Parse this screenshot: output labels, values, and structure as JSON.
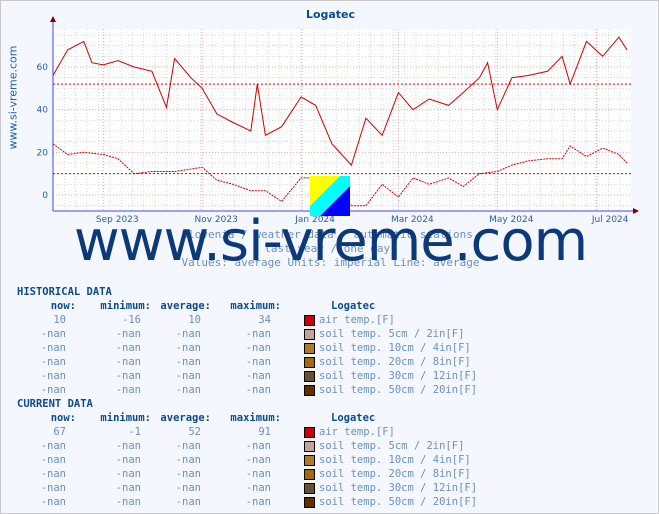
{
  "title": "Logatec",
  "side_text": "www.si-vreme.com",
  "watermark": "www.si-vreme.com",
  "subtitle": [
    "Slovenia / weather data - automatic stations.",
    "last year / one day.",
    "Values: average  Units: imperial  Line: average"
  ],
  "chart_data": {
    "type": "line",
    "title": "Logatec",
    "ylim": [
      -7,
      78
    ],
    "yticks": [
      0,
      20,
      40,
      60
    ],
    "xticks": [
      "Sep 2023",
      "Nov 2023",
      "Jan 2024",
      "Mar 2024",
      "May 2024",
      "Jul 2024"
    ],
    "xtick_dates": [
      "2023-09-01",
      "2023-11-01",
      "2024-01-01",
      "2024-03-01",
      "2024-05-01",
      "2024-07-01"
    ],
    "x_range": [
      "2023-08-01",
      "2024-07-20"
    ],
    "grid": true,
    "avg_lines": [
      52,
      10
    ],
    "series": [
      {
        "style": "solid",
        "color": "#cc0000",
        "points": [
          [
            "2023-08-01",
            56
          ],
          [
            "2023-08-10",
            68
          ],
          [
            "2023-08-20",
            72
          ],
          [
            "2023-08-25",
            62
          ],
          [
            "2023-09-01",
            61
          ],
          [
            "2023-09-10",
            63
          ],
          [
            "2023-09-20",
            60
          ],
          [
            "2023-10-01",
            58
          ],
          [
            "2023-10-10",
            41
          ],
          [
            "2023-10-15",
            64
          ],
          [
            "2023-10-25",
            55
          ],
          [
            "2023-11-01",
            50
          ],
          [
            "2023-11-10",
            38
          ],
          [
            "2023-11-20",
            34
          ],
          [
            "2023-12-01",
            30
          ],
          [
            "2023-12-05",
            52
          ],
          [
            "2023-12-10",
            28
          ],
          [
            "2023-12-20",
            32
          ],
          [
            "2024-01-01",
            46
          ],
          [
            "2024-01-10",
            42
          ],
          [
            "2024-01-20",
            24
          ],
          [
            "2024-02-01",
            14
          ],
          [
            "2024-02-10",
            36
          ],
          [
            "2024-02-20",
            28
          ],
          [
            "2024-03-01",
            48
          ],
          [
            "2024-03-10",
            40
          ],
          [
            "2024-03-20",
            45
          ],
          [
            "2024-04-01",
            42
          ],
          [
            "2024-04-10",
            48
          ],
          [
            "2024-04-20",
            55
          ],
          [
            "2024-04-25",
            62
          ],
          [
            "2024-05-01",
            40
          ],
          [
            "2024-05-10",
            55
          ],
          [
            "2024-05-20",
            56
          ],
          [
            "2024-06-01",
            58
          ],
          [
            "2024-06-10",
            65
          ],
          [
            "2024-06-15",
            52
          ],
          [
            "2024-06-25",
            72
          ],
          [
            "2024-07-05",
            65
          ],
          [
            "2024-07-15",
            74
          ],
          [
            "2024-07-20",
            68
          ]
        ]
      },
      {
        "style": "dashed",
        "color": "#cc0000",
        "points": [
          [
            "2023-08-01",
            24
          ],
          [
            "2023-08-10",
            19
          ],
          [
            "2023-08-20",
            20
          ],
          [
            "2023-09-01",
            19
          ],
          [
            "2023-09-10",
            17
          ],
          [
            "2023-09-20",
            10
          ],
          [
            "2023-10-01",
            11
          ],
          [
            "2023-10-15",
            11
          ],
          [
            "2023-11-01",
            13
          ],
          [
            "2023-11-10",
            7
          ],
          [
            "2023-11-20",
            5
          ],
          [
            "2023-12-01",
            2
          ],
          [
            "2023-12-10",
            2
          ],
          [
            "2023-12-20",
            -3
          ],
          [
            "2024-01-01",
            8
          ],
          [
            "2024-01-10",
            8
          ],
          [
            "2024-01-20",
            3
          ],
          [
            "2024-02-01",
            -5
          ],
          [
            "2024-02-10",
            -5
          ],
          [
            "2024-02-20",
            5
          ],
          [
            "2024-03-01",
            -1
          ],
          [
            "2024-03-10",
            8
          ],
          [
            "2024-03-20",
            5
          ],
          [
            "2024-04-01",
            8
          ],
          [
            "2024-04-10",
            4
          ],
          [
            "2024-04-20",
            10
          ],
          [
            "2024-05-01",
            11
          ],
          [
            "2024-05-10",
            14
          ],
          [
            "2024-05-20",
            16
          ],
          [
            "2024-06-01",
            17
          ],
          [
            "2024-06-10",
            17
          ],
          [
            "2024-06-15",
            23
          ],
          [
            "2024-06-25",
            18
          ],
          [
            "2024-07-05",
            22
          ],
          [
            "2024-07-15",
            19
          ],
          [
            "2024-07-20",
            15
          ]
        ]
      }
    ]
  },
  "historical": {
    "heading": "HISTORICAL DATA",
    "headers": [
      "now:",
      "minimum:",
      "average:",
      "maximum:",
      "Logatec"
    ],
    "rows": [
      [
        "10",
        "-16",
        "10",
        "34",
        "air temp.[F]",
        "#cc0000"
      ],
      [
        "-nan",
        "-nan",
        "-nan",
        "-nan",
        "soil temp. 5cm / 2in[F]",
        "#c8a0a0"
      ],
      [
        "-nan",
        "-nan",
        "-nan",
        "-nan",
        "soil temp. 10cm / 4in[F]",
        "#b07830"
      ],
      [
        "-nan",
        "-nan",
        "-nan",
        "-nan",
        "soil temp. 20cm / 8in[F]",
        "#a86800"
      ],
      [
        "-nan",
        "-nan",
        "-nan",
        "-nan",
        "soil temp. 30cm / 12in[F]",
        "#665030"
      ],
      [
        "-nan",
        "-nan",
        "-nan",
        "-nan",
        "soil temp. 50cm / 20in[F]",
        "#603000"
      ]
    ]
  },
  "current": {
    "heading": "CURRENT DATA",
    "headers": [
      "now:",
      "minimum:",
      "average:",
      "maximum:",
      "Logatec"
    ],
    "rows": [
      [
        "67",
        "-1",
        "52",
        "91",
        "air temp.[F]",
        "#cc0000"
      ],
      [
        "-nan",
        "-nan",
        "-nan",
        "-nan",
        "soil temp. 5cm / 2in[F]",
        "#c8a0a0"
      ],
      [
        "-nan",
        "-nan",
        "-nan",
        "-nan",
        "soil temp. 10cm / 4in[F]",
        "#b07830"
      ],
      [
        "-nan",
        "-nan",
        "-nan",
        "-nan",
        "soil temp. 20cm / 8in[F]",
        "#a86800"
      ],
      [
        "-nan",
        "-nan",
        "-nan",
        "-nan",
        "soil temp. 30cm / 12in[F]",
        "#665030"
      ],
      [
        "-nan",
        "-nan",
        "-nan",
        "-nan",
        "soil temp. 50cm / 20in[F]",
        "#603000"
      ]
    ]
  }
}
